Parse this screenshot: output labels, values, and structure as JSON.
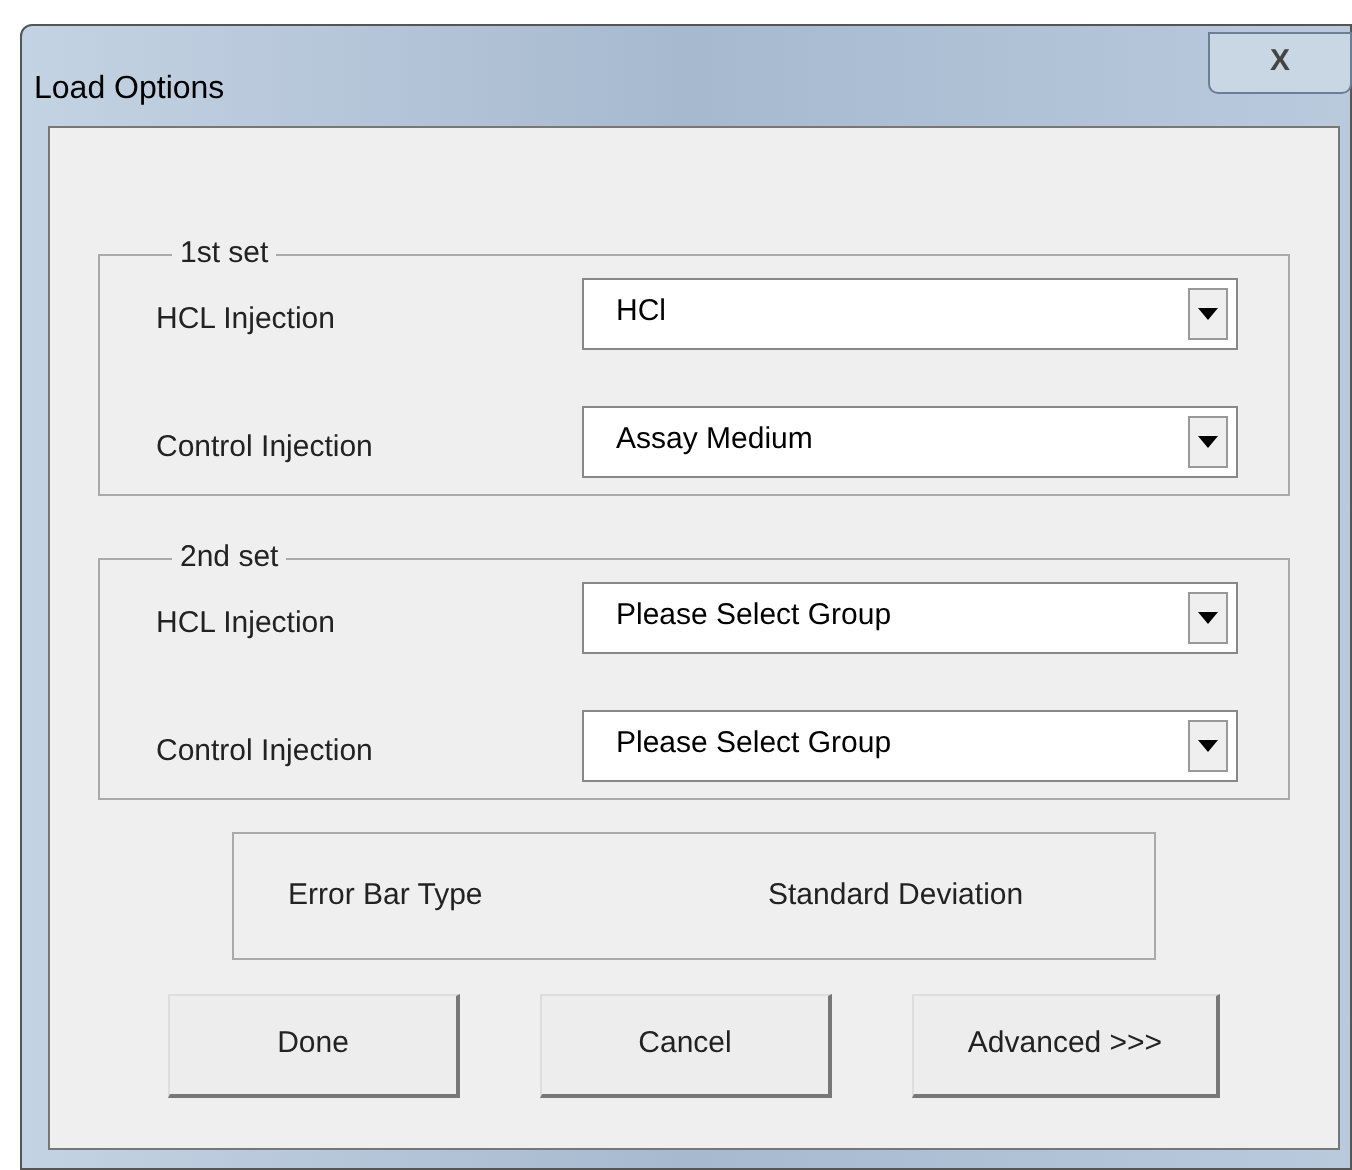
{
  "window": {
    "title": "Load Options",
    "close": "X"
  },
  "groups": [
    {
      "legend": "1st set",
      "rows": [
        {
          "label": "HCL Injection",
          "value": "HCl"
        },
        {
          "label": "Control Injection",
          "value": "Assay Medium"
        }
      ]
    },
    {
      "legend": "2nd set",
      "rows": [
        {
          "label": "HCL Injection",
          "value": "Please Select Group"
        },
        {
          "label": "Control Injection",
          "value": "Please Select Group"
        }
      ]
    }
  ],
  "error_bar": {
    "label": "Error Bar Type",
    "value": "Standard Deviation"
  },
  "buttons": [
    "Done",
    "Cancel",
    "Advanced >>>"
  ]
}
